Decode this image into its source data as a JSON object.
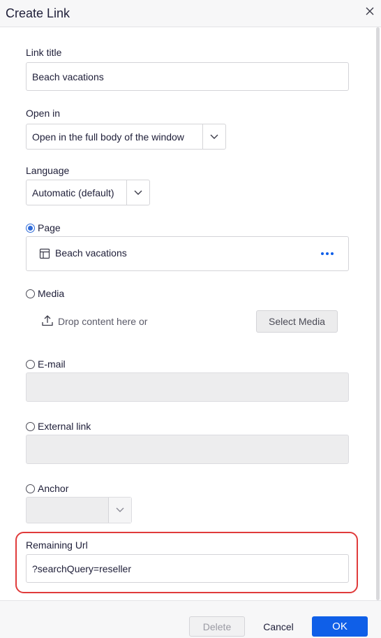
{
  "dialog": {
    "title": "Create Link"
  },
  "link_title": {
    "label": "Link title",
    "value": "Beach vacations"
  },
  "open_in": {
    "label": "Open in",
    "selected": "Open in the full body of the window"
  },
  "language": {
    "label": "Language",
    "selected": "Automatic (default)"
  },
  "page_option": {
    "label": "Page",
    "checked": true,
    "selected_page": "Beach vacations",
    "more_icon": "ellipsis-icon"
  },
  "media_option": {
    "label": "Media",
    "checked": false,
    "drop_text": "Drop content here or",
    "select_button": "Select Media"
  },
  "email_option": {
    "label": "E-mail",
    "checked": false,
    "value": ""
  },
  "external_option": {
    "label": "External link",
    "checked": false,
    "value": ""
  },
  "anchor_option": {
    "label": "Anchor",
    "checked": false,
    "selected": ""
  },
  "remaining_url": {
    "label": "Remaining Url",
    "value": "?searchQuery=reseller"
  },
  "footer": {
    "delete_label": "Delete",
    "cancel_label": "Cancel",
    "ok_label": "OK"
  },
  "colors": {
    "accent": "#0f5fe8",
    "highlight": "#e03b3b",
    "radio": "#2f6bd8"
  }
}
